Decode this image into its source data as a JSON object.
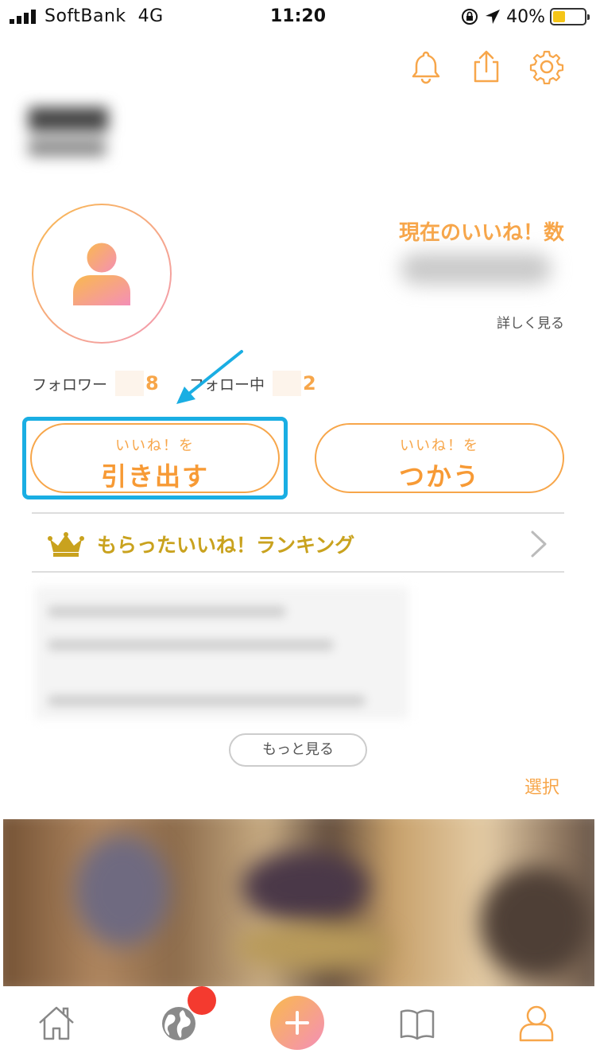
{
  "status_bar": {
    "carrier": "SoftBank",
    "network": "4G",
    "time": "11:20",
    "battery_percent": "40%",
    "battery_level": 0.4
  },
  "header": {
    "icons": [
      "bell-icon",
      "share-icon",
      "gear-icon"
    ]
  },
  "profile": {
    "likes_title": "現在のいいね！数",
    "likes_detail": "詳しく見る",
    "followers_label": "フォロワー",
    "followers_count": "8",
    "following_label": "フォロー中",
    "following_count": "2"
  },
  "actions": {
    "withdraw_small": "いいね！を",
    "withdraw_big": "引き出す",
    "use_small": "いいね！を",
    "use_big": "つかう"
  },
  "ranking": {
    "label": "もらったいいね！ランキング"
  },
  "posts": {
    "more_label": "もっと見る",
    "select_label": "選択"
  },
  "tabbar": {
    "items": [
      "home-icon",
      "globe-icon",
      "plus-icon",
      "book-icon",
      "profile-icon"
    ]
  },
  "colors": {
    "accent": "#f7a64a",
    "highlight": "#1aaee3",
    "crown": "#c9a21e",
    "badge": "#f43a2f"
  }
}
